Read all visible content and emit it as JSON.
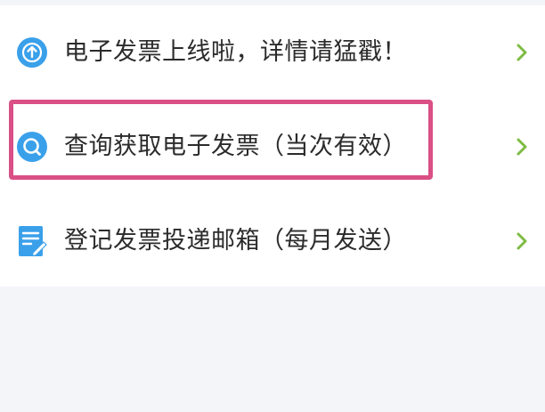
{
  "menu": {
    "items": [
      {
        "label": "电子发票上线啦，详情请猛戳！",
        "icon": "upload-circle-icon"
      },
      {
        "label": "查询获取电子发票（当次有效）",
        "icon": "search-circle-icon"
      },
      {
        "label": "登记发票投递邮箱（每月发送）",
        "icon": "document-edit-icon"
      }
    ],
    "chevron_icon": "chevron-right-icon"
  },
  "colors": {
    "background": "#f4f5f9",
    "card": "#ffffff",
    "icon_blue": "#3aa0ea",
    "chevron_green": "#7dbb42",
    "highlight_pink": "#d94f86",
    "text": "#2b2b2b"
  }
}
